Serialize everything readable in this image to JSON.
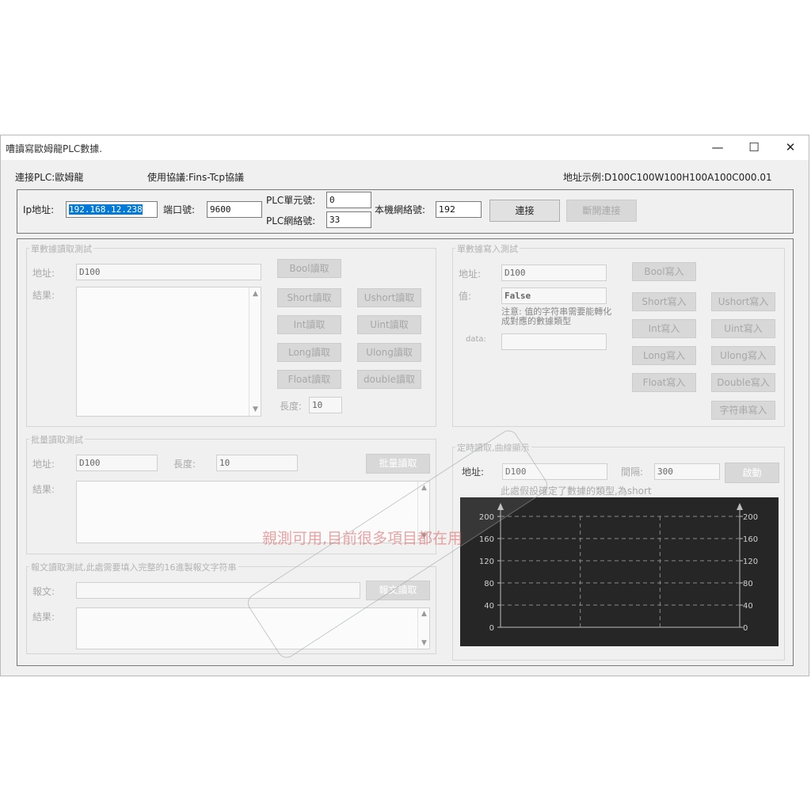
{
  "window": {
    "title": "嘈讀寫歐姆龍PLC數據.",
    "controls": {
      "minimize": "—",
      "maximize": "☐",
      "close": "✕"
    }
  },
  "header": {
    "plc_label": "連接PLC:歐姆龍",
    "protocol_label": "使用協議:Fins-Tcp協議",
    "address_example": "地址示例:D100C100W100H100A100C000.01"
  },
  "connection": {
    "ip_label": "Ip地址:",
    "ip_value": "192.168.12.238",
    "port_label": "端口號:",
    "port_value": "9600",
    "plc_unit_label": "PLC單元號:",
    "plc_unit_value": "0",
    "plc_net_label": "PLC網絡號:",
    "plc_net_value": "33",
    "local_net_label": "本機網絡號:",
    "local_net_value": "192",
    "connect_button": "連接",
    "disconnect_button": "斷開連接"
  },
  "single_read": {
    "title": "單數據讀取測試",
    "address_label": "地址:",
    "address_value": "D100",
    "result_label": "結果:",
    "buttons": {
      "bool": "Bool讀取",
      "short": "Short讀取",
      "ushort": "Ushort讀取",
      "int": "Int讀取",
      "uint": "Uint讀取",
      "long": "Long讀取",
      "ulong": "Ulong讀取",
      "float": "Float讀取",
      "double": "double讀取"
    },
    "length_label": "長度:",
    "length_value": "10"
  },
  "single_write": {
    "title": "單數據寫入測試",
    "address_label": "地址:",
    "address_value": "D100",
    "value_label": "值:",
    "value_value": "False",
    "note": "注意: 值的字符串需要能轉化成對應的數據類型",
    "data_label": "data:",
    "buttons": {
      "bool": "Bool寫入",
      "short": "Short寫入",
      "ushort": "Ushort寫入",
      "int": "Int寫入",
      "uint": "Uint寫入",
      "long": "Long寫入",
      "ulong": "Ulong寫入",
      "float": "Float寫入",
      "double": "Double寫入",
      "string": "字符串寫入"
    }
  },
  "batch_read": {
    "title": "批量讀取測試",
    "address_label": "地址:",
    "address_value": "D100",
    "length_label": "長度:",
    "length_value": "10",
    "button": "批量讀取",
    "result_label": "結果:"
  },
  "message_read": {
    "title": "報文讀取測試,此處需要填入完整的16進製報文字符串",
    "message_label": "報文:",
    "message_value": "",
    "button": "報文讀取",
    "result_label": "結果:"
  },
  "timed_read": {
    "title": "定時讀取,曲線顯示",
    "address_label": "地址:",
    "address_value": "D100",
    "interval_label": "間隔:",
    "interval_value": "300",
    "start_button": "啟動",
    "note": "此處假設確定了數據的類型,為short"
  },
  "chart_data": {
    "type": "line",
    "title": "",
    "xlabel": "",
    "ylabel": "",
    "ylim": [
      0,
      200
    ],
    "y_ticks": [
      0,
      40,
      80,
      120,
      160,
      200
    ],
    "grid": true,
    "series": [],
    "background": "#262626"
  },
  "watermark": "親測可用,目前很多項目都在用",
  "colors": {
    "window_bg": "#f0f0f0",
    "selection": "#0078d7",
    "chart_bg": "#262626",
    "watermark": "#e06a6a"
  }
}
